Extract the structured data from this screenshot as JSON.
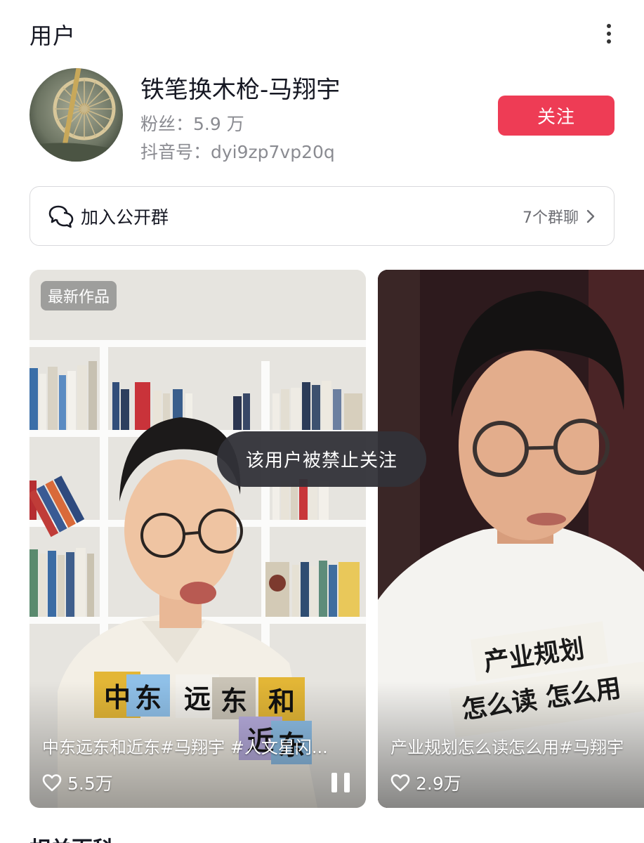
{
  "header": {
    "section_title": "用户",
    "more_icon": "more-vertical-icon"
  },
  "user": {
    "name": "铁笔换木枪-马翔宇",
    "fans": "粉丝：5.9 万",
    "douyin_id": "抖音号：dyi9zp7vp20q",
    "follow_label": "关注"
  },
  "group": {
    "icon": "chat-bubbles-icon",
    "label": "加入公开群",
    "count": "7个群聊"
  },
  "videos": [
    {
      "badge": "最新作品",
      "title": "中东远东和近东#马翔宇 #人文星闪...",
      "likes": "5.5万",
      "sticker_chars": [
        "中",
        "东",
        "远",
        "东",
        "和",
        "近",
        "东"
      ]
    },
    {
      "title": "产业规划怎么读怎么用#马翔宇",
      "likes": "2.9万",
      "note_line1": "产业规划",
      "note_line2": "怎么读 怎么用"
    }
  ],
  "toast": "该用户被禁止关注",
  "next_section": "相关百科",
  "colors": {
    "accent": "#ee3c55",
    "text_primary": "#161823",
    "text_secondary": "#8a8b91"
  }
}
